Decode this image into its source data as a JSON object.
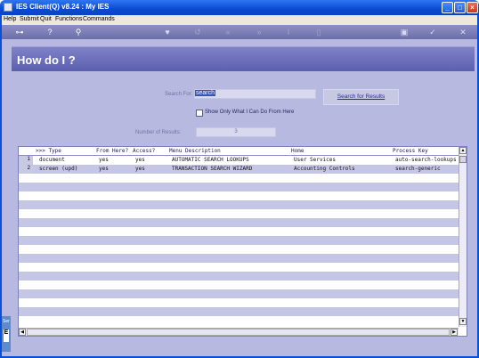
{
  "window": {
    "title": "IES Client(Q) v8.24 : My IES"
  },
  "menu": [
    "Help",
    "Submit",
    "Quit",
    "Functions",
    "Commands"
  ],
  "toolbar": {
    "icons": [
      "key-icon",
      "help-icon",
      "search-icon",
      "heart-icon",
      "history-icon",
      "rewind-icon",
      "fast-forward-icon",
      "cursor-icon",
      "page-icon",
      "print-icon",
      "check-icon",
      "close-icon"
    ]
  },
  "banner": {
    "title": "How do I ?"
  },
  "search": {
    "label": "Search For:",
    "value": "search",
    "button": "Search for Results",
    "checkbox_label": "Show Only What I Can Do From Here",
    "results_label": "Number of Results:",
    "results_value": "3"
  },
  "grid": {
    "columns": [
      ">>> Type",
      "From Here?",
      "Access?",
      "Menu Description",
      "Home",
      "Process Key"
    ],
    "rows": [
      {
        "num": "1",
        "type": "document",
        "from_here": "yes",
        "access": "yes",
        "description": "AUTOMATIC SEARCH LOOKUPS",
        "home": "User Services",
        "key": "auto-search-lookups"
      },
      {
        "num": "2",
        "type": "screen (upd)",
        "from_here": "yes",
        "access": "yes",
        "description": "TRANSACTION SEARCH WIZARD",
        "home": "Accounting Controls",
        "key": "search-generic"
      }
    ]
  },
  "side": {
    "tab_text": "Ser",
    "icon_text": "E"
  }
}
